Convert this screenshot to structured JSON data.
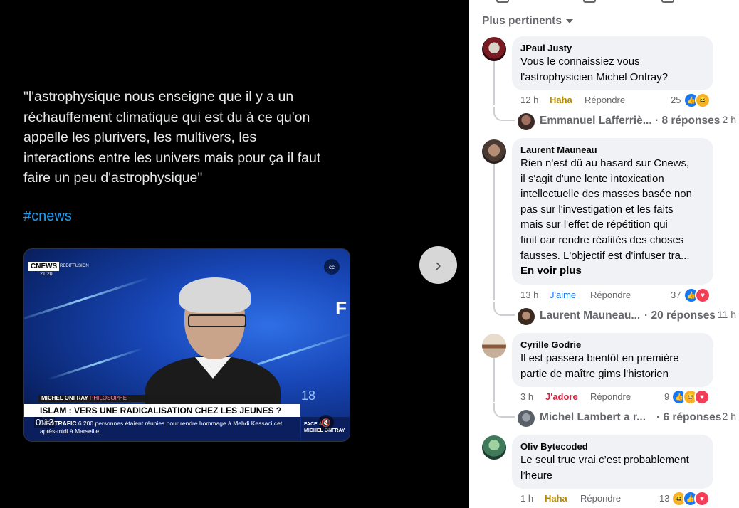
{
  "post": {
    "quote": "\"l'astrophysique nous enseigne que il y a un\nréchauffement climatique qui est du à ce qu'on\nappelle les plurivers, les multivers, les\ninteractions entre les univers mais pour ça il faut\nfaire un peu d'astrophysique\"",
    "hashtag": "#cnews",
    "video": {
      "channel": "CNEWS",
      "channel_sub": "REDIFFUSION",
      "clock": "21:20",
      "guest_name": "MICHEL ONFRAY",
      "guest_role": "PHILOSOPHE",
      "headline": "ISLAM : VERS UNE RADICALISATION CHEZ LES JEUNES ?",
      "ticker_label": "INFOTRAFIC",
      "ticker_text": "6 200 personnes étaient réunies pour rendre hommage à Mehdi Kessaci cet après-midi à Marseille.",
      "show_tag_1": "FACE À",
      "show_tag_2": "MICHEL ONFRAY",
      "big_number": "18",
      "letter": "F",
      "timestamp": "0:13",
      "cc_icon": "cc",
      "mute_icon": "🔇"
    },
    "next_icon": "›"
  },
  "comments_panel": {
    "sort_label": "Plus pertinents",
    "comments": [
      {
        "author": "JPaul Justy",
        "text": "Vous le connaissiez vous\nl'astrophysicien Michel Onfray?",
        "time": "12 h",
        "reaction_word": "Haha",
        "reaction_color": "#b58a00",
        "reply_label": "Répondre",
        "count": "25",
        "emojis": [
          "like",
          "haha"
        ],
        "reply_preview": {
          "name": "Emmanuel Lafferriè...",
          "count": "· 8 réponses",
          "time": "2 h"
        }
      },
      {
        "author": "Laurent Mauneau",
        "text": "Rien n'est dû au hasard sur Cnews,\nil s'agit d'une lente intoxication\nintellectuelle des masses basée non\npas sur l'investigation et les faits\nmais sur l'effet de répétition qui\nfinit oar rendre réalités des choses\nfausses. L'objectif est d'infuser tra...",
        "see_more": "En voir plus",
        "time": "13 h",
        "reaction_word": "J'aime",
        "reaction_color": "#1877f2",
        "reply_label": "Répondre",
        "count": "37",
        "emojis": [
          "like",
          "love"
        ],
        "reply_preview": {
          "name": "Laurent Mauneau...",
          "count": "· 20 réponses",
          "time": "11 h"
        }
      },
      {
        "author": "Cyrille Godrie",
        "text": "Il est passera bientôt en première\npartie de maître gims l'historien",
        "time": "3 h",
        "reaction_word": "J'adore",
        "reaction_color": "#e41e3f",
        "reply_label": "Répondre",
        "count": "9",
        "emojis": [
          "like",
          "haha",
          "love"
        ],
        "reply_preview": {
          "name": "Michel Lambert a r...",
          "count": "· 6 réponses",
          "time": "2 h"
        }
      },
      {
        "author": "Oliv Bytecoded",
        "text": "Le seul truc vrai c’est probablement\nl’heure",
        "time": "1 h",
        "reaction_word": "Haha",
        "reaction_color": "#b58a00",
        "reply_label": "Répondre",
        "count": "13",
        "emojis": [
          "haha",
          "like",
          "love"
        ]
      }
    ]
  },
  "colors": {
    "left_bg": "#000000",
    "quote_text": "#e7e9ea",
    "hashtag": "#1d9bf0",
    "bubble_bg": "#f0f2f5",
    "like": "#1877f2",
    "love": "#f33e58",
    "haha": "#f7b125"
  }
}
